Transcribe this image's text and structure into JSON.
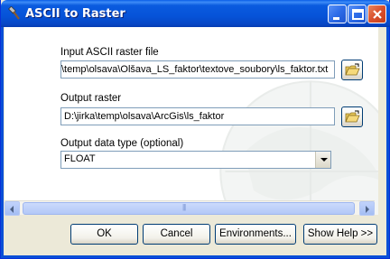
{
  "window": {
    "title": "ASCII to Raster"
  },
  "titlebar_buttons": {
    "minimize": "minimize",
    "maximize": "maximize",
    "close": "close"
  },
  "form": {
    "input_label": "Input ASCII raster file",
    "input_value": "\\temp\\olsava\\Olšava_LS_faktor\\textove_soubory\\ls_faktor.txt",
    "output_label": "Output raster",
    "output_value": "D:\\jirka\\temp\\olsava\\ArcGis\\ls_faktor",
    "type_label": "Output data type (optional)",
    "type_value": "FLOAT"
  },
  "buttons": {
    "ok": "OK",
    "cancel": "Cancel",
    "environments": "Environments...",
    "show_help": "Show Help >>"
  },
  "colors": {
    "titlebar": "#0653d8",
    "frame": "#0a4fd6",
    "close": "#d9502d"
  }
}
